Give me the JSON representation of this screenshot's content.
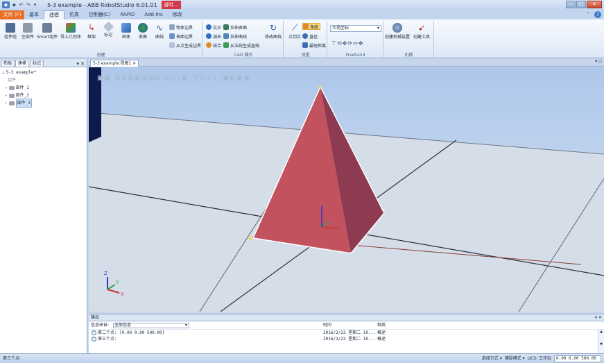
{
  "window": {
    "title": "5-3 example - ABB RobotStudio 6.01.01",
    "context_tab": "部件..."
  },
  "ribbon": {
    "file_tab": "文件 (F)",
    "tabs": [
      "基本",
      "建模",
      "仿真",
      "控制器(C)",
      "RAPID",
      "Add-Ins",
      "修改"
    ],
    "create_group": {
      "label": "创建",
      "buttons": [
        "组件组",
        "空部件",
        "Smart组件",
        "导入几何体",
        "框架",
        "标记",
        "固体",
        "表面",
        "曲线"
      ]
    },
    "cad_group": {
      "label": "CAD 操作",
      "buttons": [
        "物体边界",
        "表面边界",
        "从点生成边界",
        "交叉",
        "减去",
        "结合",
        "拉伸表面",
        "拉伸曲线",
        "从法线生成直线",
        "修改曲线"
      ]
    },
    "measure_group": {
      "label": "测量",
      "buttons": [
        "点到点",
        "角度",
        "直径",
        "最短距离"
      ]
    },
    "freehand_group": {
      "label": "Freehand",
      "frame_selector": "大地坐标"
    },
    "mechanism_group": {
      "label": "机械",
      "buttons": [
        "创建机械装置",
        "创建工具"
      ]
    }
  },
  "left_panel": {
    "tabs": [
      "布局",
      "建模",
      "标记"
    ],
    "tree_root": "5-3 example*",
    "section_label": "组件",
    "parts": [
      "部件_1",
      "部件_2",
      "部件_3"
    ]
  },
  "document": {
    "tab_label": "5-3 example:视图1"
  },
  "output": {
    "title": "输出",
    "filter_label": "信息来自:",
    "filter_value": "全部信息",
    "col_time": "时间",
    "col_category": "种类",
    "rows": [
      {
        "message": "第二个点: [0.00 0.00 500.00]",
        "time": "2016/2/23 星期二 10...",
        "category": "概述"
      },
      {
        "message": "第三个点:",
        "time": "2016/2/23 星期二 10...",
        "category": "概述"
      }
    ]
  },
  "status": {
    "left": "第三个点:",
    "select_mode": "选择方式",
    "snap_mode": "捕捉模式",
    "ucs_label": "UCS: 工作站",
    "ucs_value": "0.00  0.00  500.00"
  },
  "axes": {
    "x": "X",
    "y": "Y",
    "z": "Z"
  },
  "colors": {
    "pyramid_left": "#c3525f",
    "pyramid_right": "#8e3b52",
    "file_tab": "#e86f25",
    "context_tab": "#d2384a"
  }
}
